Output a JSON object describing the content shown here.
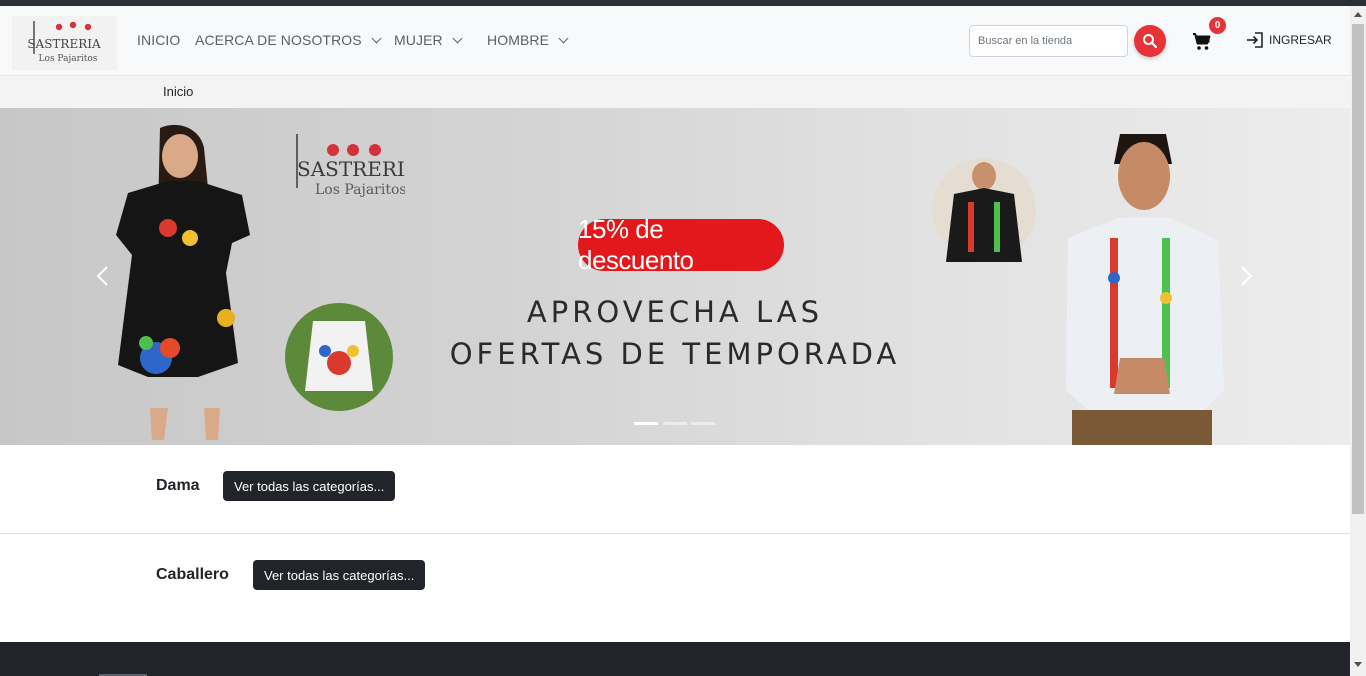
{
  "nav": {
    "items": [
      {
        "label": "INICIO"
      },
      {
        "label": "ACERCA DE NOSOTROS"
      },
      {
        "label": "MUJER"
      },
      {
        "label": "HOMBRE"
      }
    ],
    "search_placeholder": "Buscar en la tienda",
    "cart_count": "0",
    "login_label": "INGRESAR"
  },
  "logo": {
    "line1": "SASTRERIA",
    "line2": "Los Pajaritos"
  },
  "breadcrumb": {
    "current": "Inicio"
  },
  "hero": {
    "brand_line1": "SASTRERIA",
    "brand_line2": "Los Pajaritos",
    "discount": "15% de descuento",
    "headline_line1": "APROVECHA LAS",
    "headline_line2": "OFERTAS DE TEMPORADA",
    "slide_count": 3,
    "active_slide": 1
  },
  "categories": [
    {
      "title": "Dama",
      "button": "Ver todas las categorías..."
    },
    {
      "title": "Caballero",
      "button": "Ver todas las categorías..."
    }
  ],
  "colors": {
    "accent": "#e53338",
    "dark": "#212529",
    "promo": "#e3181d"
  }
}
